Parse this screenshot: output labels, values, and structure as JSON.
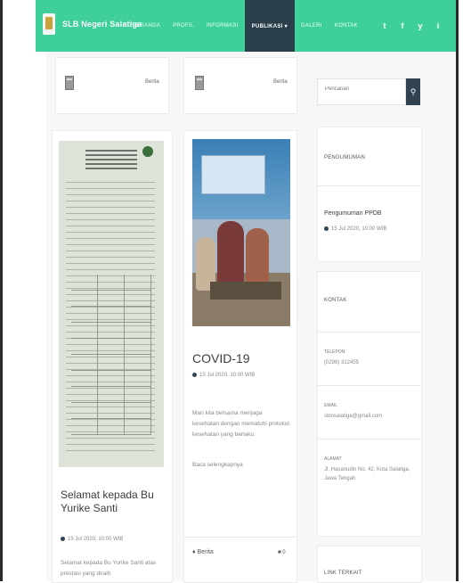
{
  "header": {
    "brand": "SLB Negeri Salatiga",
    "nav": [
      {
        "label": "BERANDA"
      },
      {
        "label": "PROFIL"
      },
      {
        "label": "INFORMASI"
      },
      {
        "label": "PUBLIKASI ▾"
      },
      {
        "label": "GALERI"
      },
      {
        "label": "KONTAK"
      }
    ],
    "socials": [
      "t",
      "f",
      "y",
      "i"
    ]
  },
  "posts": [
    {
      "category": "Berita"
    },
    {
      "category": "Berita"
    }
  ],
  "article_left": {
    "title": "Selamat kepada Bu Yurike Santi",
    "date": "15 Jul 2020, 10:00 WIB",
    "excerpt": "Selamat kepada Bu Yurike Santi atas prestasi yang diraih"
  },
  "article_mid": {
    "title": "COVID-19",
    "date": "15 Jul 2020, 10:00 WIB",
    "excerpt": "Mari kita bersama menjaga kesehatan dengan mematuhi protokol kesehatan yang berlaku.",
    "read_more": "Baca selengkapnya",
    "footer_tag": "Berita",
    "footer_count": "0"
  },
  "sidebar": {
    "search_placeholder": "Pencarian",
    "announcement_heading": "PENGUMUMAN",
    "announcement_title": "Pengumuman PPDB",
    "announcement_date": "15 Jul 2020, 10:00 WIB",
    "contact_heading": "KONTAK",
    "phone_label": "TELEPON",
    "phone_value": "(0298) 312455",
    "email_label": "EMAIL",
    "email_value": "slbnsalatiga@gmail.com",
    "address_label": "ALAMAT",
    "address_value": "Jl. Hasanudin No. 42, Kota Salatiga, Jawa Tengah",
    "links_heading": "LINK TERKAIT"
  }
}
